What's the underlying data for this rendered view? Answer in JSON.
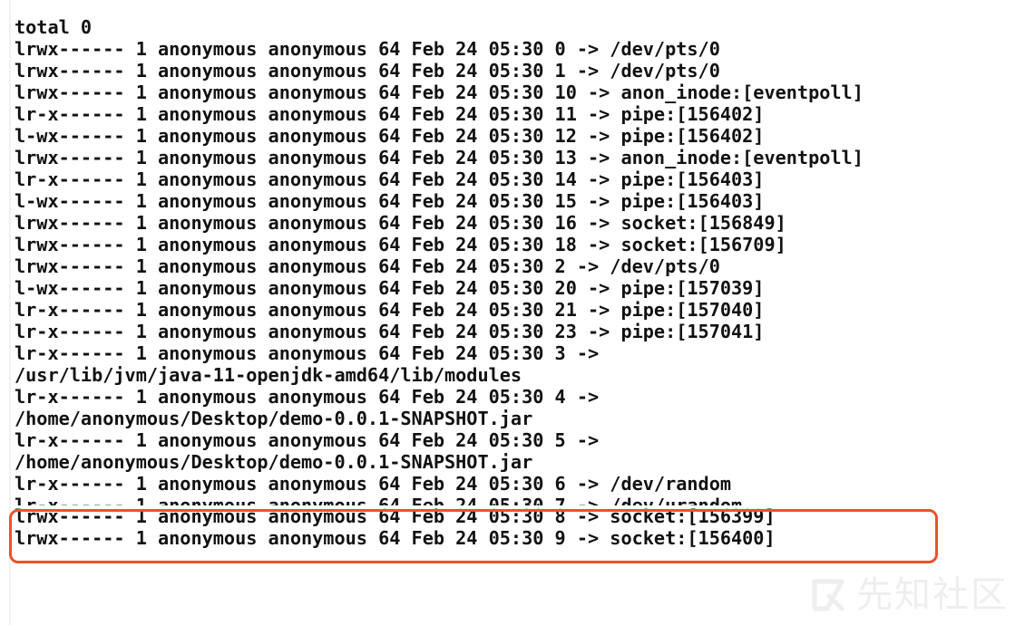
{
  "terminal": {
    "lines": [
      "total 0",
      "lrwx------ 1 anonymous anonymous 64 Feb 24 05:30 0 -> /dev/pts/0",
      "lrwx------ 1 anonymous anonymous 64 Feb 24 05:30 1 -> /dev/pts/0",
      "lrwx------ 1 anonymous anonymous 64 Feb 24 05:30 10 -> anon_inode:[eventpoll]",
      "lr-x------ 1 anonymous anonymous 64 Feb 24 05:30 11 -> pipe:[156402]",
      "l-wx------ 1 anonymous anonymous 64 Feb 24 05:30 12 -> pipe:[156402]",
      "lrwx------ 1 anonymous anonymous 64 Feb 24 05:30 13 -> anon_inode:[eventpoll]",
      "lr-x------ 1 anonymous anonymous 64 Feb 24 05:30 14 -> pipe:[156403]",
      "l-wx------ 1 anonymous anonymous 64 Feb 24 05:30 15 -> pipe:[156403]",
      "lrwx------ 1 anonymous anonymous 64 Feb 24 05:30 16 -> socket:[156849]",
      "lrwx------ 1 anonymous anonymous 64 Feb 24 05:30 18 -> socket:[156709]",
      "lrwx------ 1 anonymous anonymous 64 Feb 24 05:30 2 -> /dev/pts/0",
      "l-wx------ 1 anonymous anonymous 64 Feb 24 05:30 20 -> pipe:[157039]",
      "lr-x------ 1 anonymous anonymous 64 Feb 24 05:30 21 -> pipe:[157040]",
      "lr-x------ 1 anonymous anonymous 64 Feb 24 05:30 23 -> pipe:[157041]",
      "lr-x------ 1 anonymous anonymous 64 Feb 24 05:30 3 ->",
      "/usr/lib/jvm/java-11-openjdk-amd64/lib/modules",
      "lr-x------ 1 anonymous anonymous 64 Feb 24 05:30 4 ->",
      "/home/anonymous/Desktop/demo-0.0.1-SNAPSHOT.jar",
      "lr-x------ 1 anonymous anonymous 64 Feb 24 05:30 5 ->",
      "/home/anonymous/Desktop/demo-0.0.1-SNAPSHOT.jar",
      "lr-x------ 1 anonymous anonymous 64 Feb 24 05:30 6 -> /dev/random",
      "lr-x------ 1 anonymous anonymous 64 Feb 24 05:30 7 -> /dev/urandom",
      "lrwx------ 1 anonymous anonymous 64 Feb 24 05:30 8 -> socket:[156399]",
      "lrwx------ 1 anonymous anonymous 64 Feb 24 05:30 9 -> socket:[156400]"
    ]
  },
  "highlight": {
    "color": "#e8542a"
  },
  "watermark": {
    "text": "先知社区",
    "icon": "xianzhi-logo-icon"
  }
}
